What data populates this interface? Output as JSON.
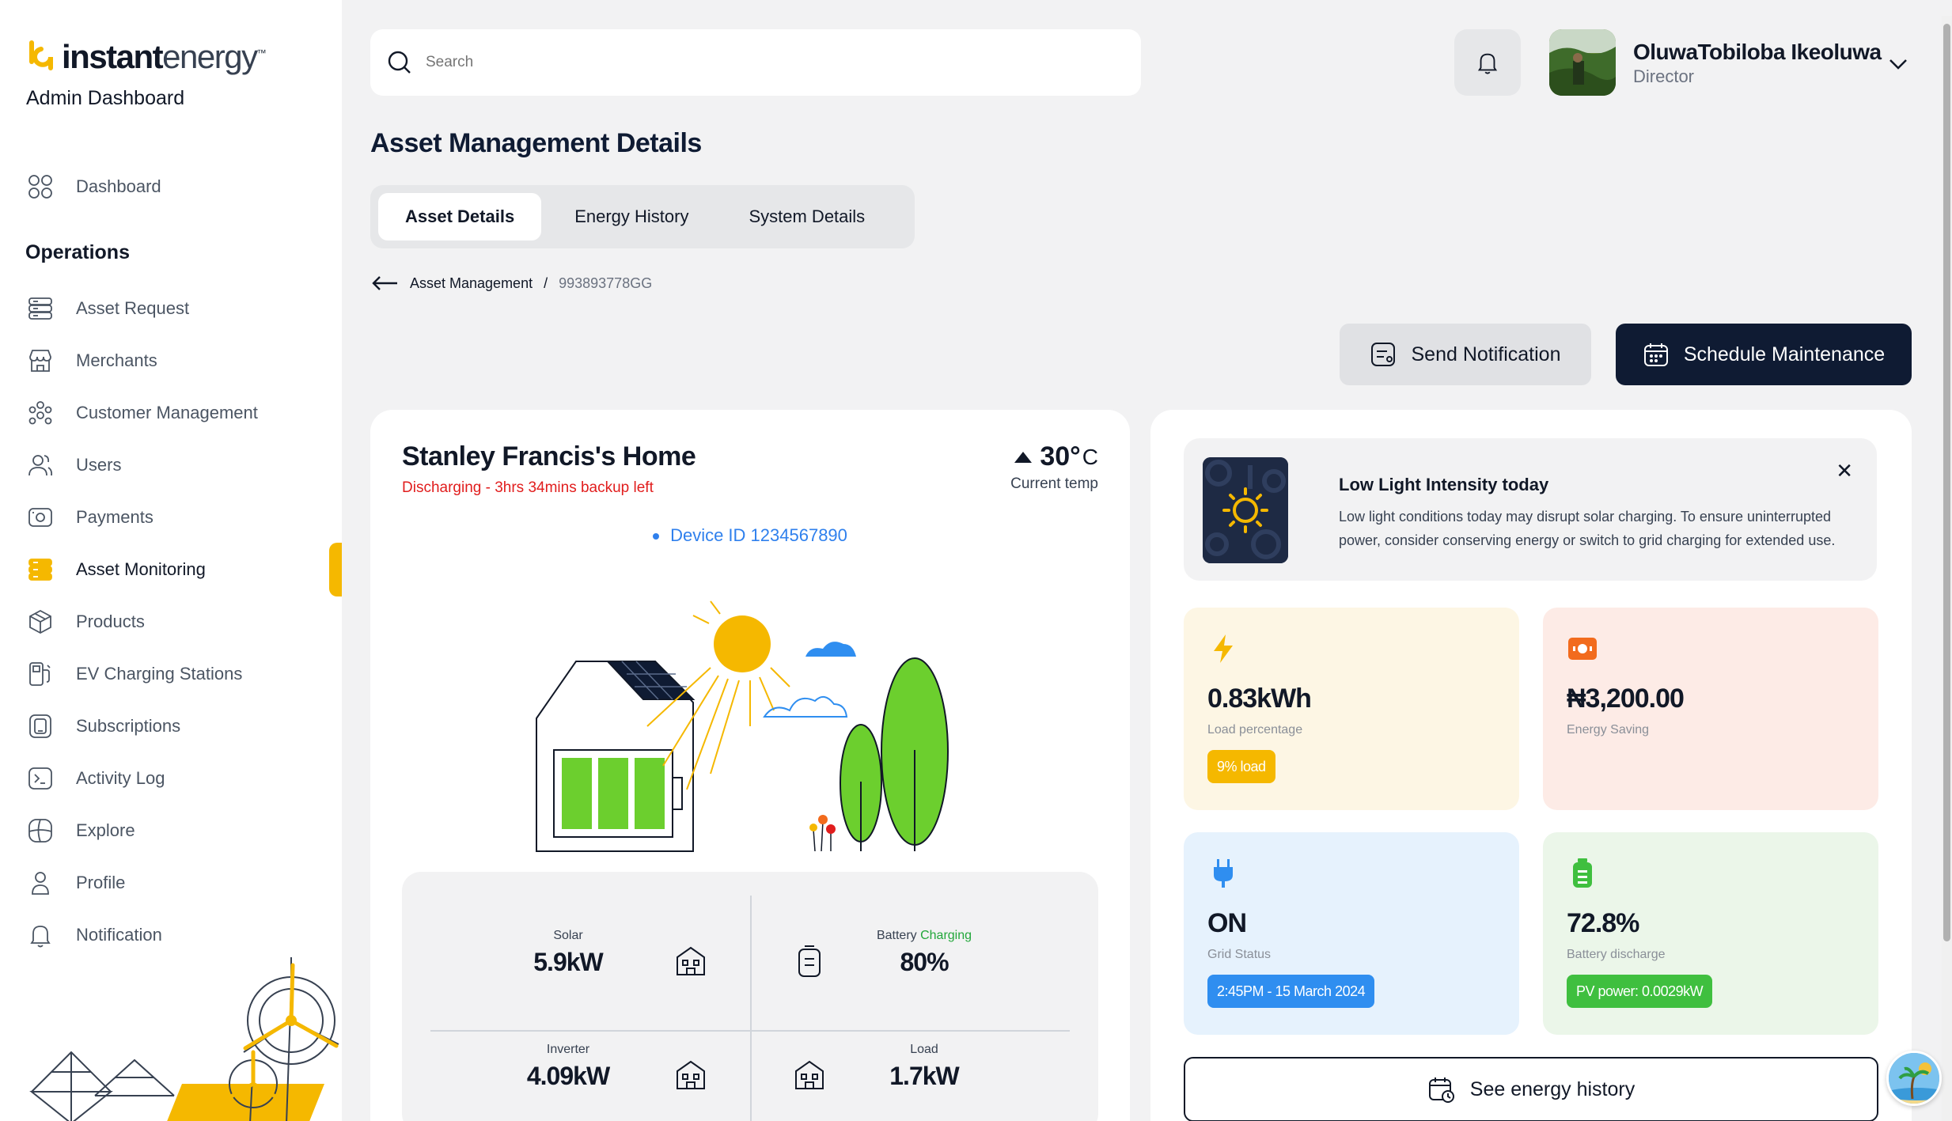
{
  "brand": {
    "name_bold": "instant",
    "name_light": "energy",
    "tm": "™",
    "subtitle": "Admin Dashboard",
    "accent_color": "#f5b800",
    "dark_color": "#0f1b33"
  },
  "sidebar": {
    "dashboard": {
      "label": "Dashboard",
      "icon": "grid-icon"
    },
    "section_title": "Operations",
    "items": [
      {
        "label": "Asset Request",
        "icon": "server-icon"
      },
      {
        "label": "Merchants",
        "icon": "storefront-icon"
      },
      {
        "label": "Customer Management",
        "icon": "people-group-icon"
      },
      {
        "label": "Users",
        "icon": "users-icon"
      },
      {
        "label": "Payments",
        "icon": "wallet-icon"
      },
      {
        "label": "Asset Monitoring",
        "icon": "server-icon",
        "active": true
      },
      {
        "label": "Products",
        "icon": "box-icon"
      },
      {
        "label": "EV Charging Stations",
        "icon": "fuel-station-icon"
      },
      {
        "label": "Subscriptions",
        "icon": "tablet-icon"
      },
      {
        "label": "Activity Log",
        "icon": "terminal-icon"
      },
      {
        "label": "Explore",
        "icon": "compass-icon"
      },
      {
        "label": "Profile",
        "icon": "person-icon"
      },
      {
        "label": "Notification",
        "icon": "bell-icon"
      }
    ]
  },
  "topbar": {
    "search_placeholder": "Search",
    "user_name": "OluwaTobiloba Ikeoluwa",
    "user_role": "Director"
  },
  "page": {
    "title": "Asset Management Details",
    "tabs": [
      "Asset Details",
      "Energy History",
      "System Details"
    ],
    "active_tab": "Asset Details",
    "breadcrumb_parent": "Asset Management",
    "breadcrumb_sep": "/",
    "breadcrumb_current": "993893778GG",
    "send_notification": "Send Notification",
    "schedule_maintenance": "Schedule Maintenance"
  },
  "home": {
    "title": "Stanley Francis's Home",
    "status": "Discharging - 3hrs 34mins backup left",
    "temp_value": "30°",
    "temp_unit": "C",
    "temp_label": "Current temp",
    "device_id": "Device ID 1234567890",
    "stats": {
      "solar_label": "Solar",
      "solar_value": "5.9kW",
      "battery_label": "Battery",
      "battery_status": "Charging",
      "battery_value": "80%",
      "inverter_label": "Inverter",
      "inverter_value": "4.09kW",
      "load_label": "Load",
      "load_value": "1.7kW"
    }
  },
  "alert": {
    "title": "Low Light Intensity today",
    "text": "Low light conditions today may disrupt solar charging. To ensure uninterrupted power, consider conserving energy or switch to grid charging for extended use.",
    "close": "✕"
  },
  "tiles": {
    "load": {
      "value": "0.83kWh",
      "label": "Load percentage",
      "badge": "9% load",
      "color": "#f5b800",
      "bg": "#fdf6e4"
    },
    "saving": {
      "value": "₦3,200.00",
      "label": "Energy Saving",
      "color": "#f26b1d",
      "bg": "#fdebe6"
    },
    "grid": {
      "value": "ON",
      "label": "Grid Status",
      "badge": "2:45PM - 15 March 2024",
      "color": "#2f8ef0",
      "bg": "#e6f2fd"
    },
    "battery": {
      "value": "72.8%",
      "label": "Battery discharge",
      "badge": "PV power: 0.0029kW",
      "color": "#3fbf3f",
      "bg": "#ebf6e9"
    }
  },
  "energy_history_button": "See energy history"
}
